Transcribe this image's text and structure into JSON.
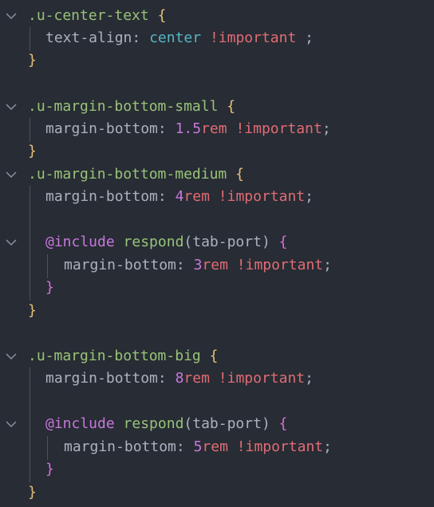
{
  "editor": {
    "theme_colors": {
      "background": "#282c34",
      "selector": "#98c379",
      "property": "#abb2bf",
      "keyword": "#56b6c2",
      "number": "#c678dd",
      "important": "#e06c75",
      "brace_outer": "#e5c07b",
      "brace_inner": "#d670d6"
    },
    "lines": {
      "l1": {
        "selector": ".u-center-text",
        "brace": "{"
      },
      "l2": {
        "prop": "text-align:",
        "value": "center",
        "imp": "!important",
        "end": " ;"
      },
      "l3": {
        "brace": "}"
      },
      "l5": {
        "selector": ".u-margin-bottom-small",
        "brace": "{"
      },
      "l6": {
        "prop": "margin-bottom:",
        "num": "1.5",
        "unit": "rem",
        "imp": "!important",
        "end": ";"
      },
      "l7": {
        "brace": "}"
      },
      "l8": {
        "selector": ".u-margin-bottom-medium",
        "brace": "{"
      },
      "l9": {
        "prop": "margin-bottom:",
        "num": "4",
        "unit": "rem",
        "imp": "!important",
        "end": ";"
      },
      "l11": {
        "at": "@include",
        "fn": "respond",
        "open": "(",
        "arg": "tab-port",
        "close": ")",
        "brace": "{"
      },
      "l12": {
        "prop": "margin-bottom:",
        "num": "3",
        "unit": "rem",
        "imp": "!important",
        "end": ";"
      },
      "l13": {
        "brace": "}"
      },
      "l14": {
        "brace": "}"
      },
      "l16": {
        "selector": ".u-margin-bottom-big",
        "brace": "{"
      },
      "l17": {
        "prop": "margin-bottom:",
        "num": "8",
        "unit": "rem",
        "imp": "!important",
        "end": ";"
      },
      "l19": {
        "at": "@include",
        "fn": "respond",
        "open": "(",
        "arg": "tab-port",
        "close": ")",
        "brace": "{"
      },
      "l20": {
        "prop": "margin-bottom:",
        "num": "5",
        "unit": "rem",
        "imp": "!important",
        "end": ";"
      },
      "l21": {
        "brace": "}"
      },
      "l22": {
        "brace": "}"
      }
    }
  }
}
